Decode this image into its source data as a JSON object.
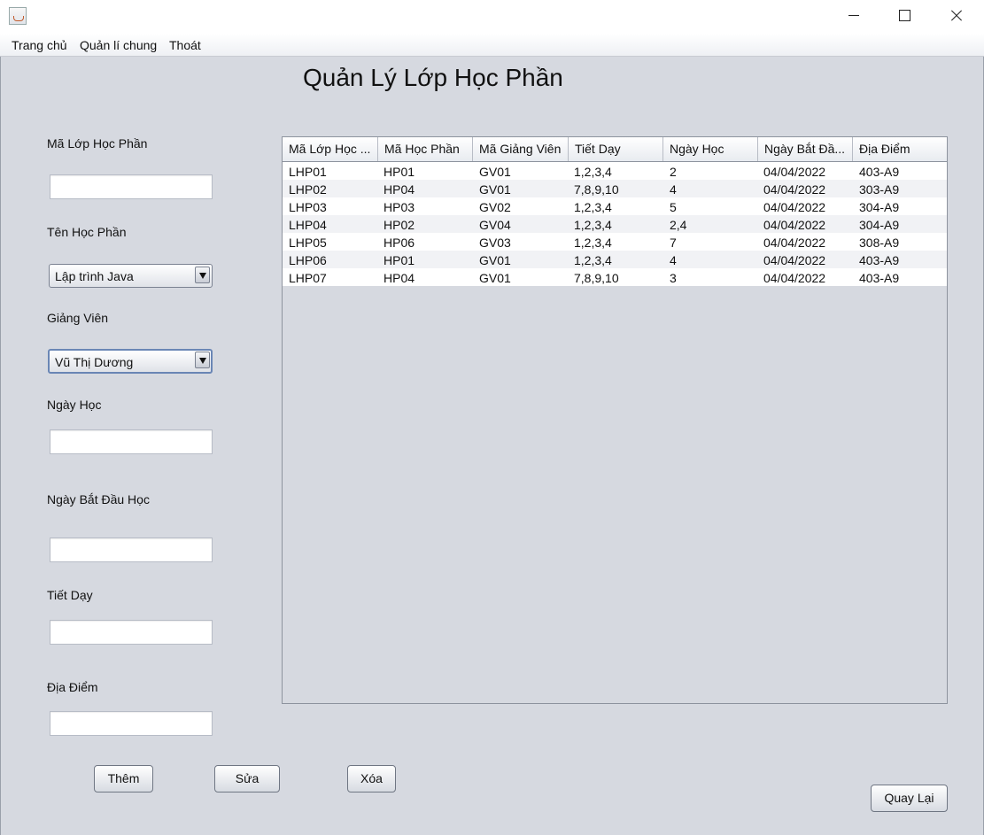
{
  "window": {
    "app_icon": "java-coffee-icon"
  },
  "menu": [
    "Trang chủ",
    "Quản lí chung",
    "Thoát"
  ],
  "title": "Quản Lý Lớp Học Phần",
  "form": {
    "ma_lop_label": "Mã Lớp Học Phần",
    "ma_lop_value": "",
    "ten_hp_label": "Tên Học Phần",
    "ten_hp_selected": "Lập trình Java",
    "giang_vien_label": "Giảng Viên",
    "giang_vien_selected": "Vũ Thị Dương",
    "ngay_hoc_label": "Ngày Học",
    "ngay_hoc_value": "",
    "ngay_bd_label": "Ngày Bắt Đầu Học",
    "ngay_bd_value": "",
    "tiet_day_label": "Tiết Dạy",
    "tiet_day_value": "",
    "dia_diem_label": "Địa Điểm",
    "dia_diem_value": ""
  },
  "table": {
    "columns": [
      "Mã Lớp Học ...",
      "Mã Học Phần",
      "Mã Giảng Viên",
      "Tiết Dạy",
      "Ngày Học",
      "Ngày Bắt Đầ...",
      "Địa Điểm"
    ],
    "rows": [
      [
        "LHP01",
        "HP01",
        "GV01",
        "1,2,3,4",
        "2",
        "04/04/2022",
        "403-A9"
      ],
      [
        "LHP02",
        "HP04",
        "GV01",
        "7,8,9,10",
        "4",
        "04/04/2022",
        "303-A9"
      ],
      [
        "LHP03",
        "HP03",
        "GV02",
        "1,2,3,4",
        "5",
        "04/04/2022",
        "304-A9"
      ],
      [
        "LHP04",
        "HP02",
        "GV04",
        "1,2,3,4",
        "2,4",
        "04/04/2022",
        "304-A9"
      ],
      [
        "LHP05",
        "HP06",
        "GV03",
        "1,2,3,4",
        "7",
        "04/04/2022",
        "308-A9"
      ],
      [
        "LHP06",
        "HP01",
        "GV01",
        "1,2,3,4",
        "4",
        "04/04/2022",
        "403-A9"
      ],
      [
        "LHP07",
        "HP04",
        "GV01",
        "7,8,9,10",
        "3",
        "04/04/2022",
        "403-A9"
      ]
    ]
  },
  "buttons": {
    "them": "Thêm",
    "sua": "Sửa",
    "xoa": "Xóa",
    "quay_lai": "Quay Lại"
  }
}
